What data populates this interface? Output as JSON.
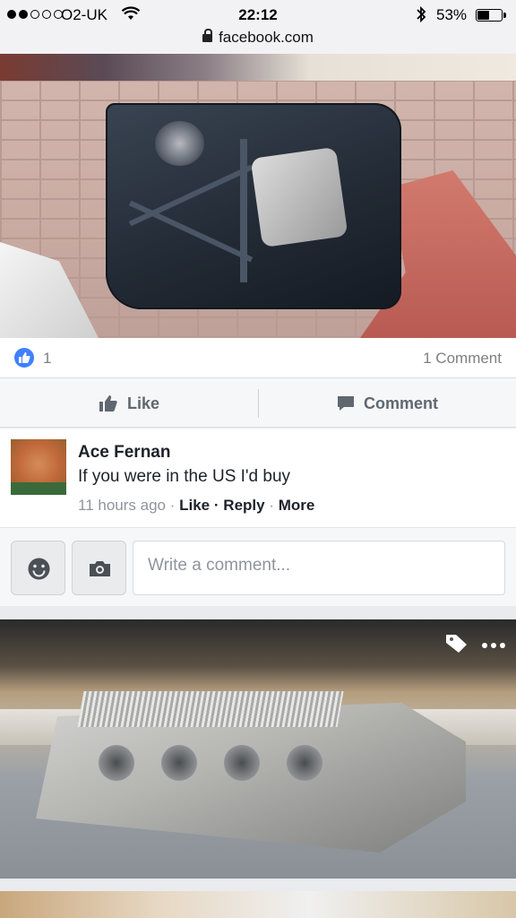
{
  "status_bar": {
    "carrier": "O2-UK",
    "time": "22:12",
    "battery": "53%",
    "battery_level": 0.53
  },
  "browser": {
    "url": "facebook.com"
  },
  "post1": {
    "likes": "1",
    "comments": "1 Comment",
    "actions": {
      "like": "Like",
      "comment": "Comment"
    }
  },
  "comment": {
    "author": "Ace Fernan",
    "text": "If you were in the US I'd buy",
    "time": "11 hours ago",
    "sep": "·",
    "like": "Like",
    "reply": "Reply",
    "more": "More"
  },
  "composer": {
    "placeholder": "Write a comment..."
  },
  "icons": {
    "signal": "signal-dots-icon",
    "wifi": "wifi-icon",
    "bluetooth": "bluetooth-icon",
    "lock": "lock-icon",
    "like": "thumbs-up-icon",
    "comment": "speech-bubble-icon",
    "emoji": "smiley-icon",
    "camera": "camera-icon",
    "tag": "tag-icon",
    "more": "more-dots-icon"
  },
  "colors": {
    "facebook_blue": "#4080ff",
    "meta_grey": "#90949c",
    "action_grey": "#606770"
  }
}
